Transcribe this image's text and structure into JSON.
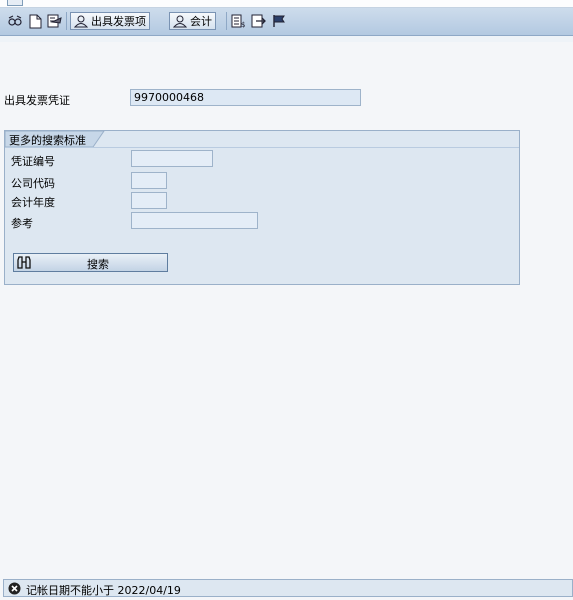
{
  "toolbar": {
    "button_issue_item": "出具发票项",
    "button_accounting": "会计"
  },
  "main": {
    "voucher_label": "出具发票凭证",
    "voucher_value": "9970000468"
  },
  "search_group": {
    "title": "更多的搜索标准",
    "fields": [
      {
        "label": "凭证编号",
        "value": ""
      },
      {
        "label": "公司代码",
        "value": ""
      },
      {
        "label": "会计年度",
        "value": ""
      },
      {
        "label": "参考",
        "value": ""
      }
    ],
    "search_button_label": "搜索"
  },
  "status_bar": {
    "type": "error",
    "message": "记帐日期不能小于 2022/04/19"
  }
}
